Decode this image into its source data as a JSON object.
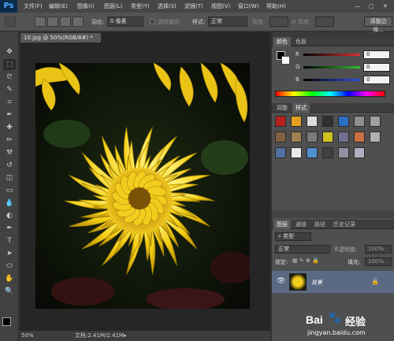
{
  "app": {
    "logo": "Ps"
  },
  "menu": {
    "items": [
      "文件(F)",
      "编辑(E)",
      "图像(I)",
      "图层(L)",
      "类型(Y)",
      "选择(S)",
      "滤镜(T)",
      "视图(V)",
      "窗口(W)",
      "帮助(H)"
    ],
    "window_controls": [
      "—",
      "▢",
      "✕"
    ]
  },
  "options": {
    "feather_label": "羽化:",
    "feather_value": "0 像素",
    "antialias_label": "消除锯齿",
    "style_label": "样式:",
    "style_value": "正常",
    "width_label": "宽度:",
    "height_label": "高度:",
    "refine_edge": "调整边缘..."
  },
  "document": {
    "tab_label": "10.jpg @ 50%(RGB/8#) *",
    "zoom": "50%",
    "doc_size": "文档:2.41M/2.41M"
  },
  "color_panel": {
    "tabs": [
      "颜色",
      "色板"
    ],
    "channels": [
      {
        "label": "R",
        "value": "0",
        "color": "#e03030"
      },
      {
        "label": "G",
        "value": "0",
        "color": "#30c030"
      },
      {
        "label": "B",
        "value": "0",
        "color": "#3050e0"
      }
    ],
    "foreground": "#000000",
    "background": "#ffffff"
  },
  "styles_panel": {
    "tabs": [
      "调整",
      "样式"
    ],
    "swatches": [
      "#b82020",
      "#e0a020",
      "#dcdcdc",
      "#303030",
      "#2a6ec0",
      "#909090",
      "#a0a0a0",
      "#806040",
      "#a08050",
      "#7a7a7a",
      "#d0c020",
      "#707090",
      "#c87040",
      "#b0b0b0",
      "#5070a0",
      "#e8e8e8",
      "#5090d0",
      "#404040",
      "#9090a0",
      "#b0b0c0"
    ]
  },
  "layers_panel": {
    "tabs": [
      "图层",
      "通道",
      "路径",
      "历史记录"
    ],
    "kind_label": "类型",
    "blend_mode": "正常",
    "opacity_label": "不透明度:",
    "opacity_value": "100%",
    "lock_label": "锁定:",
    "fill_label": "填充:",
    "fill_value": "100%",
    "layers": [
      {
        "name": "背景"
      }
    ]
  },
  "watermark": {
    "brand": "Bai",
    "brand_suffix": "经验",
    "url": "jingyan.baidu.com"
  }
}
